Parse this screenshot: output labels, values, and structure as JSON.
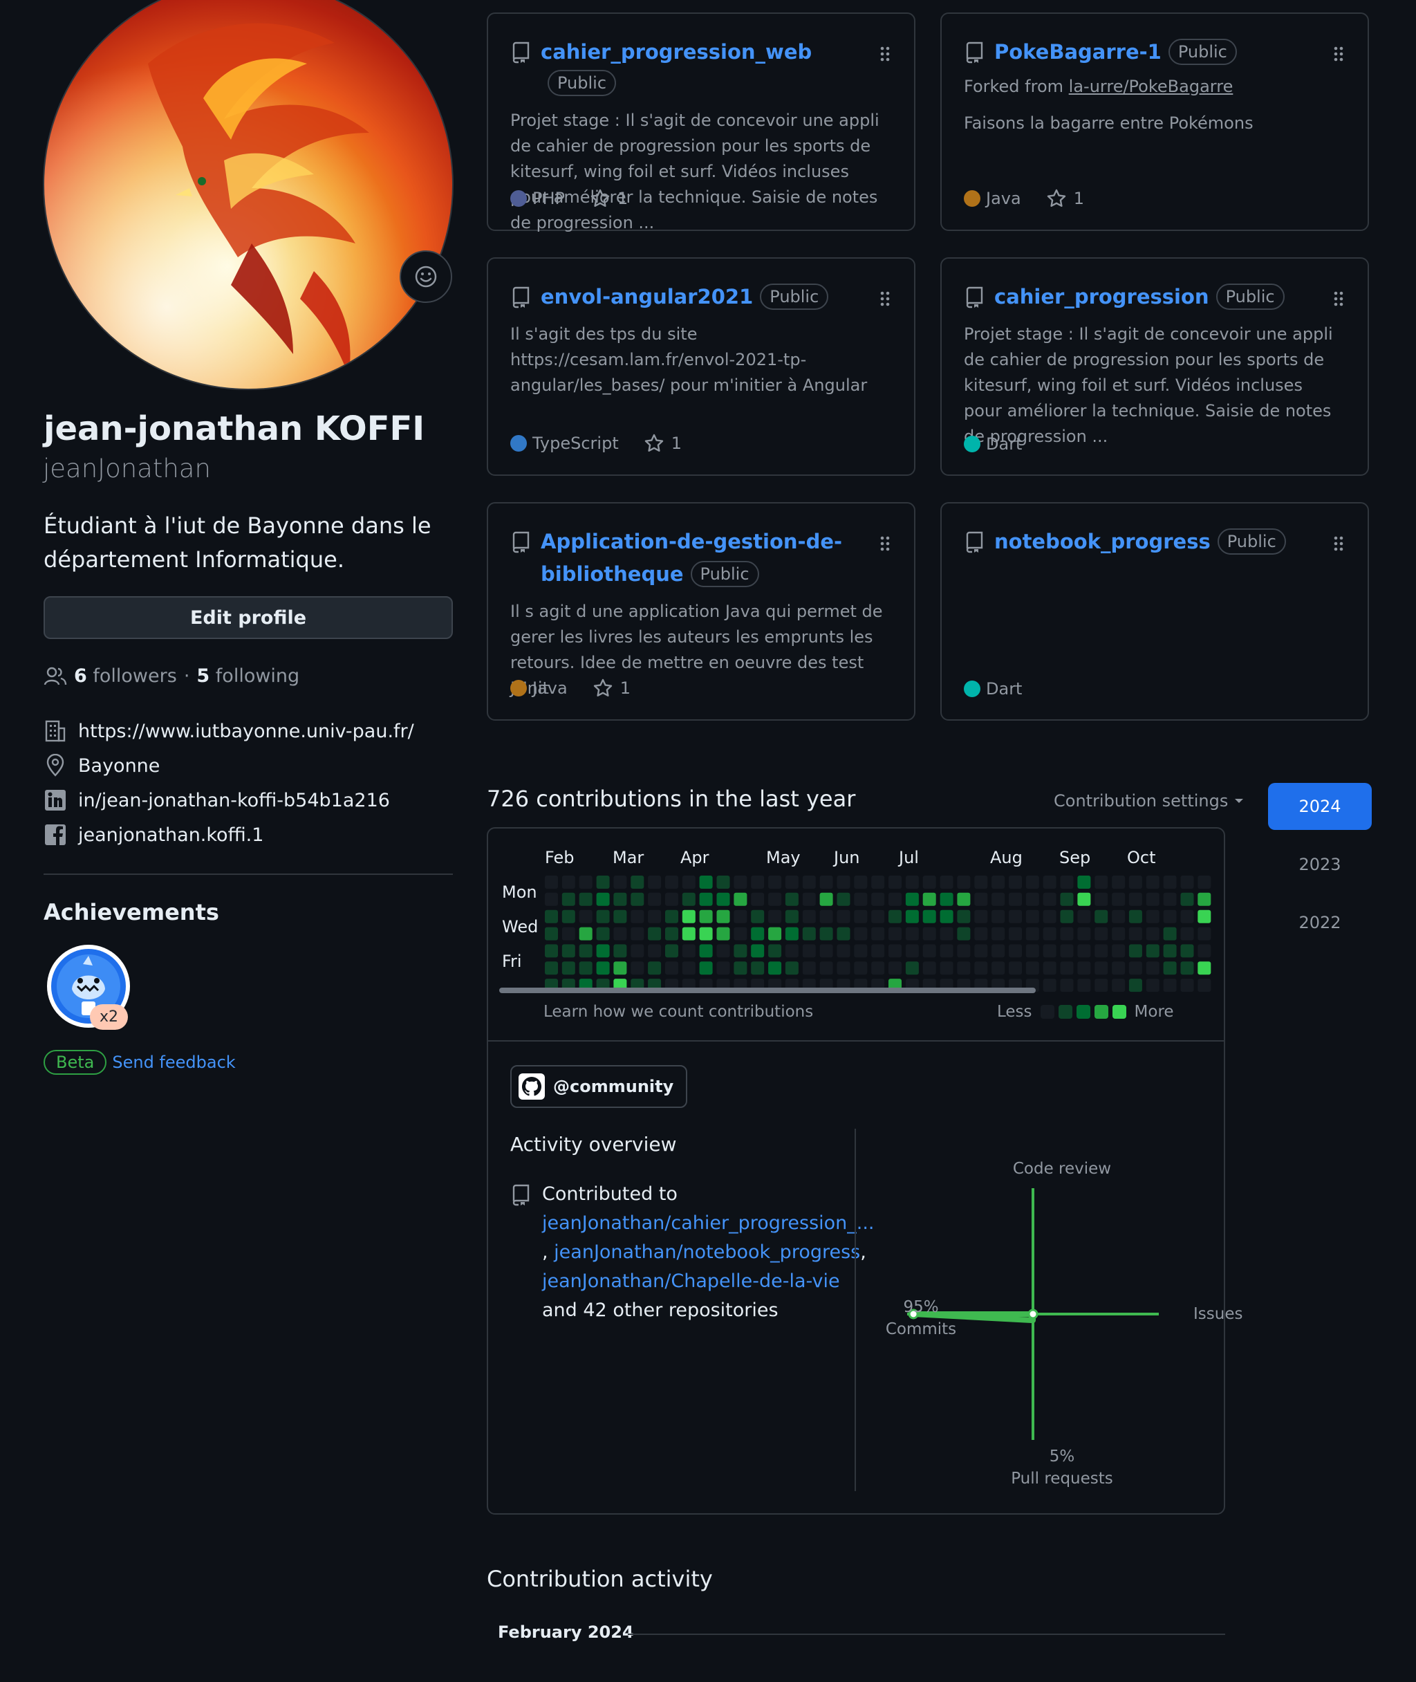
{
  "profile": {
    "name": "jean-jonathan KOFFI",
    "login": "jeanJonathan",
    "bio": "Étudiant à l'iut de Bayonne dans le département Informatique.",
    "edit_label": "Edit profile",
    "followers_count": "6",
    "followers_label": "followers",
    "sep": "·",
    "following_count": "5",
    "following_label": "following",
    "website": "https://www.iutbayonne.univ-pau.fr/",
    "location": "Bayonne",
    "linkedin": "in/jean-jonathan-koffi-b54b1a216",
    "facebook": "jeanjonathan.koffi.1"
  },
  "achievements": {
    "title": "Achievements",
    "badge_icon": "shark-achievement-icon",
    "multiplier": "x2",
    "beta_label": "Beta",
    "feedback_label": "Send feedback"
  },
  "pinned": [
    {
      "name": "cahier_progression_web",
      "visibility": "Public",
      "description": "Projet stage : Il s'agit de concevoir une appli de cahier de progression pour les sports de kitesurf, wing foil et surf. Vidéos incluses pour améliorer la technique. Saisie de notes de progression ...",
      "language": "PHP",
      "lang_color": "#4F5D95",
      "stars": "1"
    },
    {
      "name": "PokeBagarre-1",
      "visibility": "Public",
      "fork_prefix": "Forked from",
      "fork_source": "la-urre/PokeBagarre",
      "description": "Faisons la bagarre entre Pokémons",
      "language": "Java",
      "lang_color": "#b07219",
      "stars": "1"
    },
    {
      "name": "envol-angular2021",
      "visibility": "Public",
      "description": "Il s'agit des tps du site https://cesam.lam.fr/envol-2021-tp-angular/les_bases/ pour m'initier à Angular",
      "language": "TypeScript",
      "lang_color": "#3178c6",
      "stars": "1"
    },
    {
      "name": "cahier_progression",
      "visibility": "Public",
      "description": "Projet stage : Il s'agit de concevoir une appli de cahier de progression pour les sports de kitesurf, wing foil et surf. Vidéos incluses pour améliorer la technique. Saisie de notes de progression ...",
      "language": "Dart",
      "lang_color": "#00B4AB",
      "stars": ""
    },
    {
      "name": "Application-de-gestion-de-bibliotheque",
      "name_line1": "Application-de-gestion-de-",
      "name_line2": "bibliotheque",
      "visibility": "Public",
      "description": "Il s agit d une application Java qui permet de gerer les livres les auteurs les emprunts les retours. Idee de mettre en oeuvre des test JUnit",
      "language": "Java",
      "lang_color": "#b07219",
      "stars": "1"
    },
    {
      "name": "notebook_progress",
      "visibility": "Public",
      "description": "",
      "language": "Dart",
      "lang_color": "#00B4AB",
      "stars": ""
    }
  ],
  "contributions": {
    "title": "726 contributions in the last year",
    "settings_label": "Contribution settings",
    "years": [
      "2024",
      "2023",
      "2022"
    ],
    "active_year": "2024",
    "months": [
      "Feb",
      "Mar",
      "Apr",
      "May",
      "Jun",
      "Jul",
      "Aug",
      "Sep",
      "Oct"
    ],
    "days": [
      "Mon",
      "Wed",
      "Fri"
    ],
    "learn_label": "Learn how we count contributions",
    "less_label": "Less",
    "more_label": "More",
    "level_colors": [
      "#161b22",
      "#0e4429",
      "#006d32",
      "#26a641",
      "#39d353"
    ],
    "grid_weeks": [
      [
        0,
        0,
        1,
        1,
        1,
        1,
        1
      ],
      [
        0,
        1,
        1,
        0,
        1,
        1,
        1
      ],
      [
        0,
        1,
        0,
        3,
        1,
        1,
        2
      ],
      [
        1,
        2,
        1,
        1,
        2,
        2,
        1
      ],
      [
        0,
        1,
        1,
        0,
        1,
        3,
        4
      ],
      [
        1,
        1,
        0,
        0,
        0,
        0,
        1
      ],
      [
        0,
        0,
        0,
        1,
        0,
        1,
        1
      ],
      [
        0,
        0,
        1,
        1,
        1,
        0,
        0
      ],
      [
        0,
        1,
        4,
        4,
        0,
        0,
        0
      ],
      [
        2,
        2,
        3,
        4,
        2,
        2,
        0
      ],
      [
        1,
        2,
        3,
        3,
        0,
        0,
        0
      ],
      [
        0,
        3,
        0,
        0,
        1,
        1,
        0
      ],
      [
        0,
        0,
        1,
        2,
        2,
        1,
        0
      ],
      [
        0,
        0,
        0,
        3,
        1,
        2,
        0
      ],
      [
        0,
        1,
        1,
        2,
        0,
        1,
        0
      ],
      [
        0,
        0,
        0,
        1,
        0,
        0,
        0
      ],
      [
        0,
        3,
        0,
        1,
        0,
        0,
        0
      ],
      [
        0,
        1,
        0,
        1,
        0,
        0,
        0
      ],
      [
        0,
        0,
        0,
        0,
        0,
        0,
        0
      ],
      [
        0,
        0,
        0,
        0,
        0,
        0,
        0
      ],
      [
        0,
        0,
        1,
        0,
        0,
        0,
        3
      ],
      [
        0,
        2,
        2,
        0,
        0,
        1,
        0
      ],
      [
        0,
        3,
        2,
        0,
        0,
        0,
        0
      ],
      [
        0,
        2,
        2,
        0,
        0,
        0,
        0
      ],
      [
        0,
        3,
        1,
        1,
        0,
        0,
        0
      ],
      [
        0,
        0,
        0,
        0,
        0,
        0,
        0
      ],
      [
        0,
        0,
        0,
        0,
        0,
        0,
        0
      ],
      [
        0,
        0,
        0,
        0,
        0,
        0,
        0
      ],
      [
        0,
        0,
        0,
        0,
        0,
        0,
        0
      ],
      [
        0,
        0,
        0,
        0,
        0,
        0,
        0
      ],
      [
        0,
        1,
        1,
        0,
        0,
        0,
        0
      ],
      [
        2,
        4,
        0,
        0,
        0,
        0,
        0
      ],
      [
        0,
        0,
        1,
        0,
        0,
        0,
        0
      ],
      [
        0,
        0,
        0,
        0,
        0,
        0,
        0
      ],
      [
        0,
        0,
        1,
        0,
        1,
        0,
        1
      ],
      [
        0,
        0,
        0,
        0,
        1,
        0,
        0
      ],
      [
        0,
        0,
        0,
        1,
        1,
        1,
        0
      ],
      [
        0,
        1,
        0,
        0,
        1,
        1,
        0
      ],
      [
        0,
        3,
        4,
        0,
        0,
        4,
        0
      ]
    ],
    "org_label": "@community",
    "activity_title": "Activity overview",
    "contributed_prefix": "Contributed to",
    "contributed_repos": [
      "jeanJonathan/cahier_progression_...",
      "jeanJonathan/notebook_progress",
      "jeanJonathan/Chapelle-de-la-vie"
    ],
    "contributed_suffix": "and 42 other repositories",
    "chart_data": {
      "type": "radar",
      "axes": [
        "Code review",
        "Issues",
        "Pull requests",
        "Commits"
      ],
      "values": {
        "Commits": 95,
        "Pull requests": 5,
        "Code review": 0,
        "Issues": 0
      },
      "value_labels": {
        "Commits": "95%",
        "Pull requests": "5%"
      },
      "color": "#3fb950"
    },
    "activity_heading": "Contribution activity",
    "month_heading": "February 2024"
  }
}
